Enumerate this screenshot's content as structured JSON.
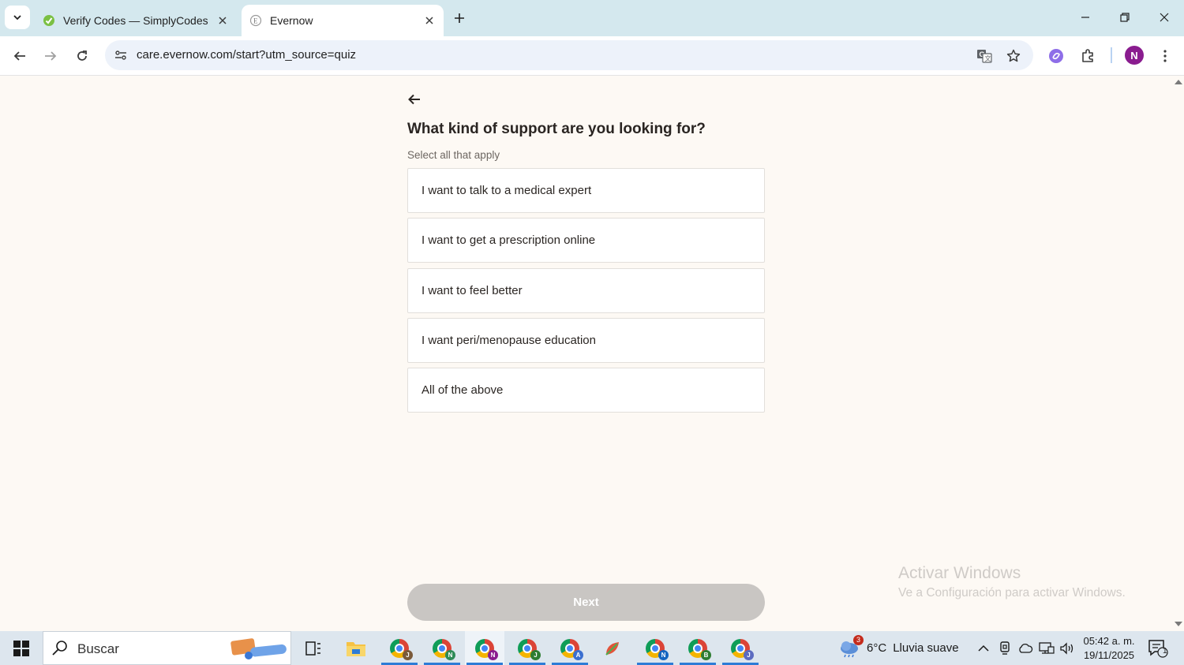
{
  "browser": {
    "tabs": [
      {
        "title": "Verify Codes — SimplyCodes",
        "favicon": "simplycodes-icon",
        "active": false
      },
      {
        "title": "Evernow",
        "favicon": "evernow-icon",
        "active": true
      }
    ],
    "url": "care.evernow.com/start?utm_source=quiz",
    "profile_initial": "N"
  },
  "quiz": {
    "question": "What kind of support are you looking for?",
    "hint": "Select all that apply",
    "options": [
      {
        "label": "I want to talk to a medical expert",
        "selected": false
      },
      {
        "label": "I want to get a prescription online",
        "selected": false
      },
      {
        "label": "I want to feel better",
        "selected": false
      },
      {
        "label": "I want peri/menopause education",
        "selected": false
      },
      {
        "label": "All of the above",
        "selected": false
      }
    ],
    "next_label": "Next",
    "next_enabled": false
  },
  "watermark": {
    "line1": "Activar Windows",
    "line2": "Ve a Configuración para activar Windows."
  },
  "taskbar": {
    "search_placeholder": "Buscar",
    "apps": [
      {
        "name": "chrome-icon",
        "badge": "J",
        "badge_color": "#7a5a3a"
      },
      {
        "name": "chrome-icon",
        "badge": "N",
        "badge_color": "#2e8b57"
      },
      {
        "name": "chrome-icon",
        "badge": "N",
        "badge_color": "#8a1c8f"
      },
      {
        "name": "chrome-icon",
        "badge": "J",
        "badge_color": "#2e7d32"
      },
      {
        "name": "chrome-icon",
        "badge": "A",
        "badge_color": "#3b6fd0"
      },
      {
        "name": "chrome-icon",
        "badge": "N",
        "badge_color": "#1565c0"
      },
      {
        "name": "chrome-icon",
        "badge": "B",
        "badge_color": "#2e7d32"
      },
      {
        "name": "chrome-icon",
        "badge": "J",
        "badge_color": "#5c6bc0"
      }
    ],
    "weather": {
      "temp": "6°C",
      "condition": "Lluvia suave",
      "alerts": "3"
    },
    "time": "05:42 a. m.",
    "date": "19/11/2025",
    "notifications": "1"
  },
  "colors": {
    "page_bg": "#fdf9f4",
    "tabstrip_bg": "#d4e8ee",
    "next_disabled": "#c9c6c3",
    "avatar": "#8a1c8f"
  }
}
